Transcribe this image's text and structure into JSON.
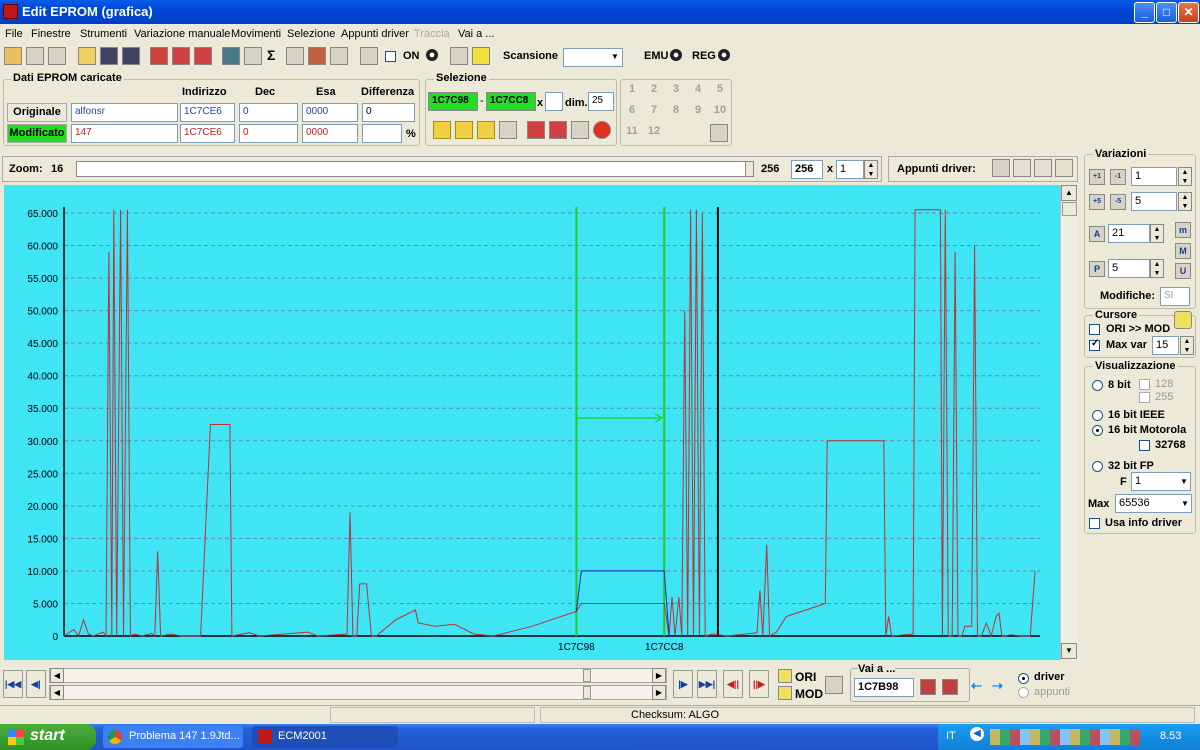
{
  "window": {
    "title": "Edit EPROM (grafica)",
    "minimize": "_",
    "maximize": "□",
    "close": "✕"
  },
  "menu": [
    "File",
    "Finestre",
    "Strumenti",
    "Variazione manuale",
    "Movimenti",
    "Selezione",
    "Appunti driver",
    "Traccia",
    "Vai a ..."
  ],
  "toolbar": {
    "on_label": "ON",
    "scan_label": "Scansione",
    "scan_value": "",
    "emu_label": "EMU",
    "reg_label": "REG"
  },
  "eprom": {
    "group_title": "Dati EPROM caricate",
    "headers": {
      "indirizzo": "Indirizzo",
      "dec": "Dec",
      "esa": "Esa",
      "differenza": "Differenza"
    },
    "original": {
      "label": "Originale",
      "name": "alfonsr",
      "address": "1C7CE6",
      "dec": "0",
      "hex": "0000",
      "diff": "0"
    },
    "modified": {
      "label": "Modificato",
      "name": "147",
      "address": "1C7CE6",
      "dec": "0",
      "hex": "0000",
      "diff": "",
      "pct": "%"
    }
  },
  "selection": {
    "group_title": "Selezione",
    "from": "1C7C98",
    "sep": "-",
    "to": "1C7CC8",
    "x_label": "x",
    "x_value": "",
    "dim_label": "dim.",
    "dim_value": "25"
  },
  "numpad": [
    "1",
    "2",
    "3",
    "4",
    "5",
    "6",
    "7",
    "8",
    "9",
    "10",
    "11",
    "12"
  ],
  "zoom": {
    "label": "Zoom:",
    "value": "16",
    "max": "256",
    "field": "256",
    "x": "x",
    "mult": "1",
    "appunti": "Appunti driver:"
  },
  "variazioni": {
    "title": "Variazioni",
    "v1": "1",
    "v2": "5",
    "v3": "21",
    "v4": "5",
    "modifiche_label": "Modifiche:",
    "modifiche_value": "SI",
    "b1": "+1",
    "b2": "-1",
    "b3": "+5",
    "b4": "-5",
    "btnA": "A",
    "btnP": "P",
    "btnm": "m",
    "btnM": "M",
    "btnU": "U"
  },
  "cursore": {
    "title": "Cursore",
    "ori_mod": "ORI >> MOD",
    "max_var_label": "Max var",
    "max_var_value": "15"
  },
  "visualizzazione": {
    "title": "Visualizzazione",
    "opt8": "8 bit",
    "c128": "128",
    "c255": "255",
    "opt16ieee": "16 bit IEEE",
    "opt16moto": "16 bit Motorola",
    "c32768": "32768",
    "opt32": "32 bit FP",
    "f_label": "F",
    "f_value": "1",
    "max_label": "Max",
    "max_value": "65536",
    "usa_info": "Usa info driver"
  },
  "bottom": {
    "ori": "ORI",
    "mod": "MOD",
    "vai_label": "Vai a ...",
    "vai_value": "1C7B98",
    "driver": "driver",
    "appunti": "appunti"
  },
  "status": {
    "checksum": "Checksum: ALGO"
  },
  "taskbar": {
    "start": "start",
    "task1": "Problema 147 1.9Jtd...",
    "task2": "ECM2001",
    "lang": "IT",
    "clock": "8.53"
  },
  "chart_data": {
    "type": "line",
    "ylim": [
      0,
      65000
    ],
    "yticks": [
      "0",
      "5.000",
      "10.000",
      "15.000",
      "20.000",
      "25.000",
      "30.000",
      "35.000",
      "40.000",
      "45.000",
      "50.000",
      "55.000",
      "60.000",
      "65.000"
    ],
    "xlim": [
      0,
      100
    ],
    "x_markers": [
      {
        "label": "1C7C98",
        "x": 52.5
      },
      {
        "label": "1C7CC8",
        "x": 61.5
      }
    ],
    "cursor_x": 67,
    "selection_arrow_y": 33500,
    "series": [
      {
        "color": "#c03030",
        "points": [
          [
            0,
            0
          ],
          [
            1,
            1000
          ],
          [
            1.5,
            0
          ],
          [
            2,
            2500
          ],
          [
            2.5,
            300
          ],
          [
            3,
            0
          ],
          [
            4,
            600
          ],
          [
            4.3,
            0
          ],
          [
            4.6,
            59000
          ],
          [
            4.9,
            0
          ],
          [
            5.1,
            65500
          ],
          [
            5.4,
            0
          ],
          [
            5.8,
            65500
          ],
          [
            6.1,
            0
          ],
          [
            6.5,
            65500
          ],
          [
            6.8,
            0
          ],
          [
            7.2,
            300
          ],
          [
            8,
            0
          ],
          [
            9,
            400
          ],
          [
            9.3,
            0
          ],
          [
            9.6,
            13000
          ],
          [
            9.9,
            0
          ],
          [
            11,
            300
          ],
          [
            12,
            0
          ],
          [
            14,
            0
          ],
          [
            15,
            32500
          ],
          [
            17,
            32500
          ],
          [
            17.2,
            0
          ],
          [
            19,
            500
          ],
          [
            20,
            0
          ],
          [
            25,
            600
          ],
          [
            26,
            0
          ],
          [
            29,
            300
          ],
          [
            29.3,
            19000
          ],
          [
            29.6,
            0
          ],
          [
            30,
            0
          ],
          [
            30.3,
            8000
          ],
          [
            31,
            8000
          ],
          [
            31.5,
            0
          ],
          [
            32,
            0
          ],
          [
            34,
            2500
          ],
          [
            36,
            4000
          ],
          [
            36.3,
            2000
          ],
          [
            38,
            1500
          ],
          [
            40,
            1800
          ],
          [
            42,
            300
          ],
          [
            44,
            0
          ],
          [
            48,
            1500
          ],
          [
            52.5,
            3800
          ],
          [
            53,
            5000
          ],
          [
            61.5,
            5000
          ],
          [
            62,
            0
          ],
          [
            62.3,
            6000
          ],
          [
            62.6,
            0
          ],
          [
            63,
            6000
          ],
          [
            63.3,
            0
          ],
          [
            63.6,
            50000
          ],
          [
            63.9,
            0
          ],
          [
            64.2,
            65500
          ],
          [
            64.5,
            0
          ],
          [
            64.8,
            65500
          ],
          [
            65.1,
            0
          ],
          [
            65.4,
            65000
          ],
          [
            65.7,
            0
          ],
          [
            66.5,
            300
          ],
          [
            68,
            0
          ],
          [
            71,
            500
          ],
          [
            71.3,
            7000
          ],
          [
            71.6,
            0
          ],
          [
            72,
            14000
          ],
          [
            72.3,
            0
          ],
          [
            73,
            600
          ],
          [
            74,
            3000
          ],
          [
            78,
            5000
          ],
          [
            78.2,
            30000
          ],
          [
            84,
            30000
          ],
          [
            84.2,
            0
          ],
          [
            84.5,
            3000
          ],
          [
            84.8,
            0
          ],
          [
            87,
            300
          ],
          [
            87.2,
            65500
          ],
          [
            89.8,
            65500
          ],
          [
            90,
            0
          ],
          [
            90.3,
            65500
          ],
          [
            90.6,
            0
          ],
          [
            91,
            0
          ],
          [
            91.3,
            59000
          ],
          [
            91.6,
            0
          ],
          [
            92,
            0
          ],
          [
            92.3,
            1500
          ],
          [
            93,
            1500
          ],
          [
            93.3,
            60000
          ],
          [
            93.6,
            0
          ],
          [
            94,
            0
          ],
          [
            94.5,
            2000
          ],
          [
            95,
            0
          ],
          [
            95.5,
            3000
          ],
          [
            95.8,
            3500
          ],
          [
            96.1,
            0
          ],
          [
            96.5,
            0
          ],
          [
            97,
            200
          ],
          [
            98,
            0
          ],
          [
            99,
            0
          ],
          [
            99.5,
            10000
          ]
        ]
      },
      {
        "color": "#2020c0",
        "points": [
          [
            52.5,
            3800
          ],
          [
            53,
            10000
          ],
          [
            61.5,
            10000
          ],
          [
            62,
            0
          ]
        ]
      }
    ]
  }
}
